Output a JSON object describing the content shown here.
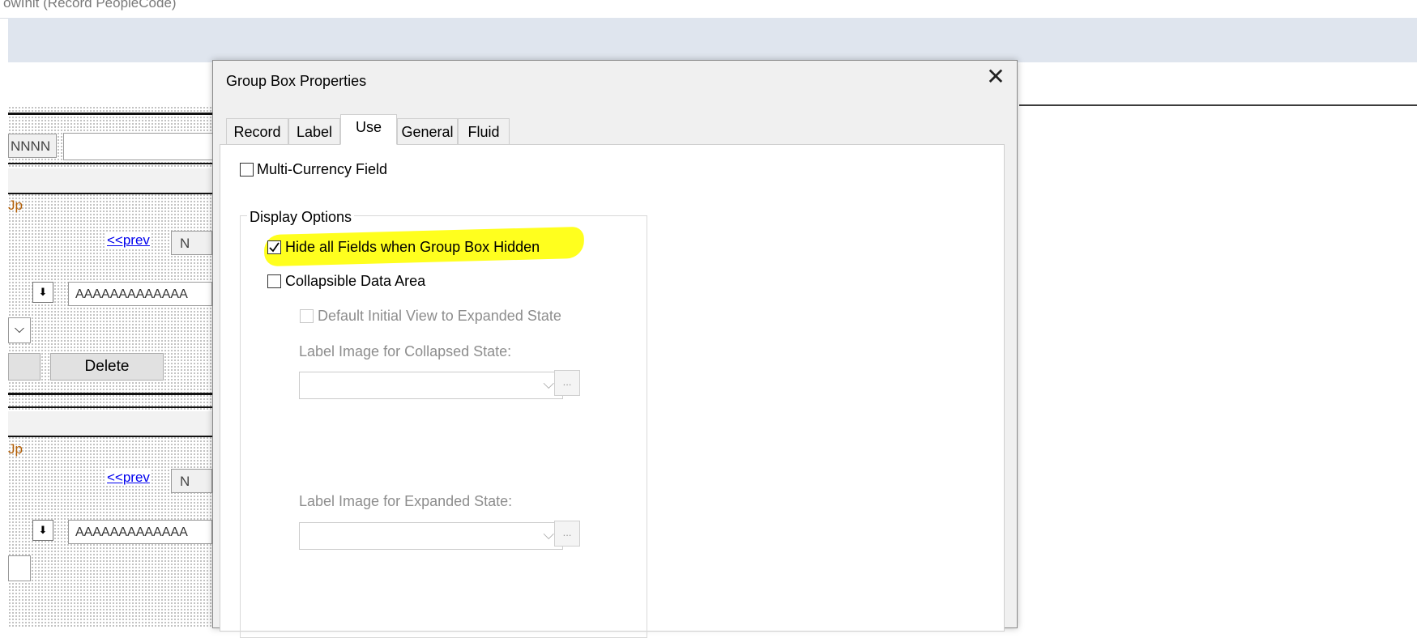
{
  "window": {
    "title_fragment": "owInit (Record PeopleCode)"
  },
  "canvas": {
    "mask_text": "NNNN",
    "scroll_title_1": "Jp",
    "scroll_title_2": "Jp",
    "prev_link_1": "<<prev",
    "prev_link_2": "<<prev",
    "nav_box_1": "N",
    "nav_box_2": "N",
    "field_text_1": "AAAAAAAAAAAAA",
    "field_text_2": "AAAAAAAAAAAAA",
    "delete_button": "Delete"
  },
  "dialog": {
    "title": "Group Box Properties",
    "close_glyph": "✕",
    "tabs": [
      {
        "label": "Record"
      },
      {
        "label": "Label"
      },
      {
        "label": "Use",
        "active": true
      },
      {
        "label": "General"
      },
      {
        "label": "Fluid"
      }
    ],
    "multi_currency": {
      "label": "Multi-Currency Field",
      "checked": false
    },
    "display_options": {
      "title": "Display Options",
      "hide_all_fields": {
        "label": "Hide all Fields when Group Box Hidden",
        "checked": true,
        "highlighted": true,
        "highlight_color": "#ffff1e"
      },
      "collapsible": {
        "label": "Collapsible Data Area",
        "checked": false
      },
      "default_expanded": {
        "label": "Default Initial View to Expanded State",
        "checked": false,
        "disabled": true
      },
      "collapsed_label": "Label Image for Collapsed State:",
      "expanded_label": "Label Image for Expanded State:",
      "browse_glyph": "..."
    }
  },
  "icons": {
    "checkmark": "check-icon",
    "dropdown": "chevron-down-icon",
    "close": "close-icon",
    "down_arrow": "down-arrow-icon"
  },
  "colors": {
    "highlight": "#ffff1e",
    "link": "#0000ee",
    "scroll_title": "#b45f06",
    "ribbon": "#dfe5ee"
  }
}
